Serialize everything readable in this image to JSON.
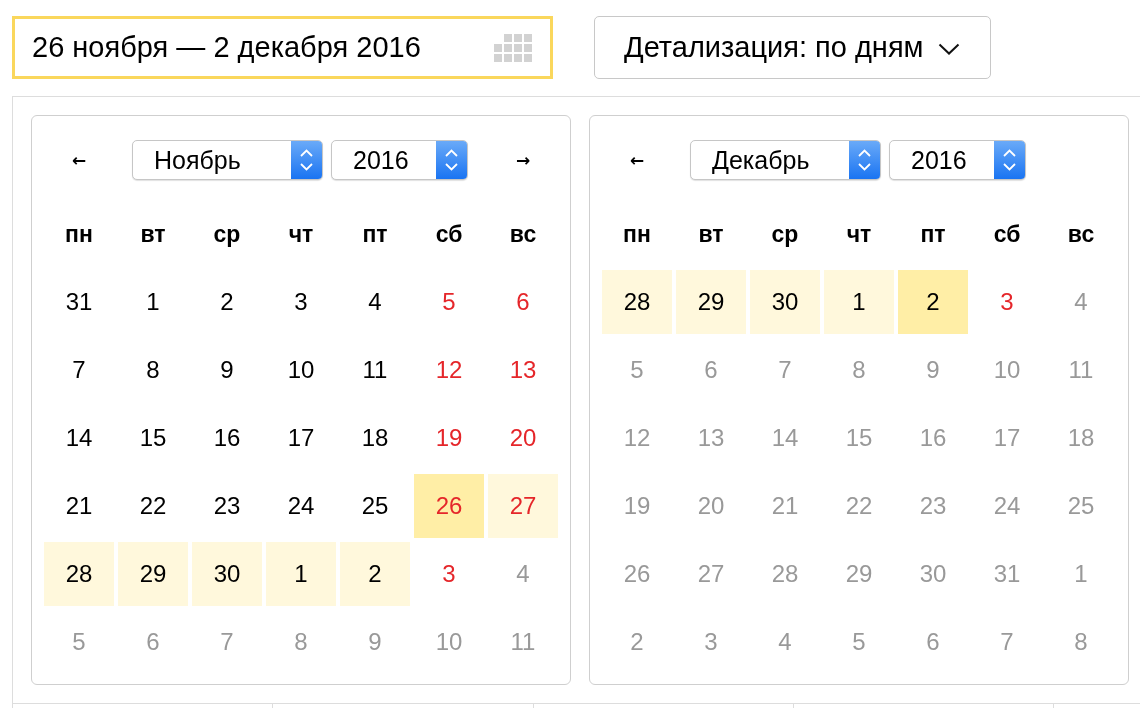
{
  "date_range_field": {
    "value": "26 ноября — 2 декабря 2016",
    "focused": true
  },
  "detail_select": {
    "label": "Детализация: по дням"
  },
  "calendars": [
    {
      "prev": "←",
      "next": "→",
      "month": "Ноябрь",
      "year": "2016",
      "weekdays": [
        "пн",
        "вт",
        "ср",
        "чт",
        "пт",
        "сб",
        "вс"
      ],
      "weeks": [
        {
          "days": [
            {
              "label": "31",
              "kind": "workday",
              "in_range": false,
              "selected": false
            },
            {
              "label": "1",
              "kind": "workday",
              "in_range": false,
              "selected": false
            },
            {
              "label": "2",
              "kind": "workday",
              "in_range": false,
              "selected": false
            },
            {
              "label": "3",
              "kind": "workday",
              "in_range": false,
              "selected": false
            },
            {
              "label": "4",
              "kind": "workday",
              "in_range": false,
              "selected": false
            },
            {
              "label": "5",
              "kind": "weekend",
              "in_range": false,
              "selected": false
            },
            {
              "label": "6",
              "kind": "weekend",
              "in_range": false,
              "selected": false
            }
          ]
        },
        {
          "days": [
            {
              "label": "7",
              "kind": "workday",
              "in_range": false,
              "selected": false
            },
            {
              "label": "8",
              "kind": "workday",
              "in_range": false,
              "selected": false
            },
            {
              "label": "9",
              "kind": "workday",
              "in_range": false,
              "selected": false
            },
            {
              "label": "10",
              "kind": "workday",
              "in_range": false,
              "selected": false
            },
            {
              "label": "11",
              "kind": "workday",
              "in_range": false,
              "selected": false
            },
            {
              "label": "12",
              "kind": "weekend",
              "in_range": false,
              "selected": false
            },
            {
              "label": "13",
              "kind": "weekend",
              "in_range": false,
              "selected": false
            }
          ]
        },
        {
          "days": [
            {
              "label": "14",
              "kind": "workday",
              "in_range": false,
              "selected": false
            },
            {
              "label": "15",
              "kind": "workday",
              "in_range": false,
              "selected": false
            },
            {
              "label": "16",
              "kind": "workday",
              "in_range": false,
              "selected": false
            },
            {
              "label": "17",
              "kind": "workday",
              "in_range": false,
              "selected": false
            },
            {
              "label": "18",
              "kind": "workday",
              "in_range": false,
              "selected": false
            },
            {
              "label": "19",
              "kind": "weekend",
              "in_range": false,
              "selected": false
            },
            {
              "label": "20",
              "kind": "weekend",
              "in_range": false,
              "selected": false
            }
          ]
        },
        {
          "days": [
            {
              "label": "21",
              "kind": "workday",
              "in_range": false,
              "selected": false
            },
            {
              "label": "22",
              "kind": "workday",
              "in_range": false,
              "selected": false
            },
            {
              "label": "23",
              "kind": "workday",
              "in_range": false,
              "selected": false
            },
            {
              "label": "24",
              "kind": "workday",
              "in_range": false,
              "selected": false
            },
            {
              "label": "25",
              "kind": "workday",
              "in_range": false,
              "selected": false
            },
            {
              "label": "26",
              "kind": "weekend",
              "in_range": false,
              "selected": true
            },
            {
              "label": "27",
              "kind": "weekend",
              "in_range": true,
              "selected": false
            }
          ]
        },
        {
          "days": [
            {
              "label": "28",
              "kind": "workday",
              "in_range": true,
              "selected": false
            },
            {
              "label": "29",
              "kind": "workday",
              "in_range": true,
              "selected": false
            },
            {
              "label": "30",
              "kind": "workday",
              "in_range": true,
              "selected": false
            },
            {
              "label": "1",
              "kind": "workday",
              "in_range": true,
              "selected": false
            },
            {
              "label": "2",
              "kind": "workday",
              "in_range": true,
              "selected": false
            },
            {
              "label": "3",
              "kind": "weekend",
              "in_range": false,
              "selected": false
            },
            {
              "label": "4",
              "kind": "disabled",
              "in_range": false,
              "selected": false
            }
          ]
        },
        {
          "days": [
            {
              "label": "5",
              "kind": "disabled",
              "in_range": false,
              "selected": false
            },
            {
              "label": "6",
              "kind": "disabled",
              "in_range": false,
              "selected": false
            },
            {
              "label": "7",
              "kind": "disabled",
              "in_range": false,
              "selected": false
            },
            {
              "label": "8",
              "kind": "disabled",
              "in_range": false,
              "selected": false
            },
            {
              "label": "9",
              "kind": "disabled",
              "in_range": false,
              "selected": false
            },
            {
              "label": "10",
              "kind": "disabled",
              "in_range": false,
              "selected": false
            },
            {
              "label": "11",
              "kind": "disabled",
              "in_range": false,
              "selected": false
            }
          ]
        }
      ]
    },
    {
      "prev": "←",
      "month": "Декабрь",
      "year": "2016",
      "weekdays": [
        "пн",
        "вт",
        "ср",
        "чт",
        "пт",
        "сб",
        "вс"
      ],
      "weeks": [
        {
          "days": [
            {
              "label": "28",
              "kind": "workday",
              "in_range": true,
              "selected": false
            },
            {
              "label": "29",
              "kind": "workday",
              "in_range": true,
              "selected": false
            },
            {
              "label": "30",
              "kind": "workday",
              "in_range": true,
              "selected": false
            },
            {
              "label": "1",
              "kind": "workday",
              "in_range": true,
              "selected": false
            },
            {
              "label": "2",
              "kind": "workday",
              "in_range": false,
              "selected": true
            },
            {
              "label": "3",
              "kind": "weekend",
              "in_range": false,
              "selected": false
            },
            {
              "label": "4",
              "kind": "disabled",
              "in_range": false,
              "selected": false
            }
          ]
        },
        {
          "days": [
            {
              "label": "5",
              "kind": "disabled",
              "in_range": false,
              "selected": false
            },
            {
              "label": "6",
              "kind": "disabled",
              "in_range": false,
              "selected": false
            },
            {
              "label": "7",
              "kind": "disabled",
              "in_range": false,
              "selected": false
            },
            {
              "label": "8",
              "kind": "disabled",
              "in_range": false,
              "selected": false
            },
            {
              "label": "9",
              "kind": "disabled",
              "in_range": false,
              "selected": false
            },
            {
              "label": "10",
              "kind": "disabled",
              "in_range": false,
              "selected": false
            },
            {
              "label": "11",
              "kind": "disabled",
              "in_range": false,
              "selected": false
            }
          ]
        },
        {
          "days": [
            {
              "label": "12",
              "kind": "disabled",
              "in_range": false,
              "selected": false
            },
            {
              "label": "13",
              "kind": "disabled",
              "in_range": false,
              "selected": false
            },
            {
              "label": "14",
              "kind": "disabled",
              "in_range": false,
              "selected": false
            },
            {
              "label": "15",
              "kind": "disabled",
              "in_range": false,
              "selected": false
            },
            {
              "label": "16",
              "kind": "disabled",
              "in_range": false,
              "selected": false
            },
            {
              "label": "17",
              "kind": "disabled",
              "in_range": false,
              "selected": false
            },
            {
              "label": "18",
              "kind": "disabled",
              "in_range": false,
              "selected": false
            }
          ]
        },
        {
          "days": [
            {
              "label": "19",
              "kind": "disabled",
              "in_range": false,
              "selected": false
            },
            {
              "label": "20",
              "kind": "disabled",
              "in_range": false,
              "selected": false
            },
            {
              "label": "21",
              "kind": "disabled",
              "in_range": false,
              "selected": false
            },
            {
              "label": "22",
              "kind": "disabled",
              "in_range": false,
              "selected": false
            },
            {
              "label": "23",
              "kind": "disabled",
              "in_range": false,
              "selected": false
            },
            {
              "label": "24",
              "kind": "disabled",
              "in_range": false,
              "selected": false
            },
            {
              "label": "25",
              "kind": "disabled",
              "in_range": false,
              "selected": false
            }
          ]
        },
        {
          "days": [
            {
              "label": "26",
              "kind": "disabled",
              "in_range": false,
              "selected": false
            },
            {
              "label": "27",
              "kind": "disabled",
              "in_range": false,
              "selected": false
            },
            {
              "label": "28",
              "kind": "disabled",
              "in_range": false,
              "selected": false
            },
            {
              "label": "29",
              "kind": "disabled",
              "in_range": false,
              "selected": false
            },
            {
              "label": "30",
              "kind": "disabled",
              "in_range": false,
              "selected": false
            },
            {
              "label": "31",
              "kind": "disabled",
              "in_range": false,
              "selected": false
            },
            {
              "label": "1",
              "kind": "disabled",
              "in_range": false,
              "selected": false
            }
          ]
        },
        {
          "days": [
            {
              "label": "2",
              "kind": "disabled",
              "in_range": false,
              "selected": false
            },
            {
              "label": "3",
              "kind": "disabled",
              "in_range": false,
              "selected": false
            },
            {
              "label": "4",
              "kind": "disabled",
              "in_range": false,
              "selected": false
            },
            {
              "label": "5",
              "kind": "disabled",
              "in_range": false,
              "selected": false
            },
            {
              "label": "6",
              "kind": "disabled",
              "in_range": false,
              "selected": false
            },
            {
              "label": "7",
              "kind": "disabled",
              "in_range": false,
              "selected": false
            },
            {
              "label": "8",
              "kind": "disabled",
              "in_range": false,
              "selected": false
            }
          ]
        }
      ]
    }
  ]
}
